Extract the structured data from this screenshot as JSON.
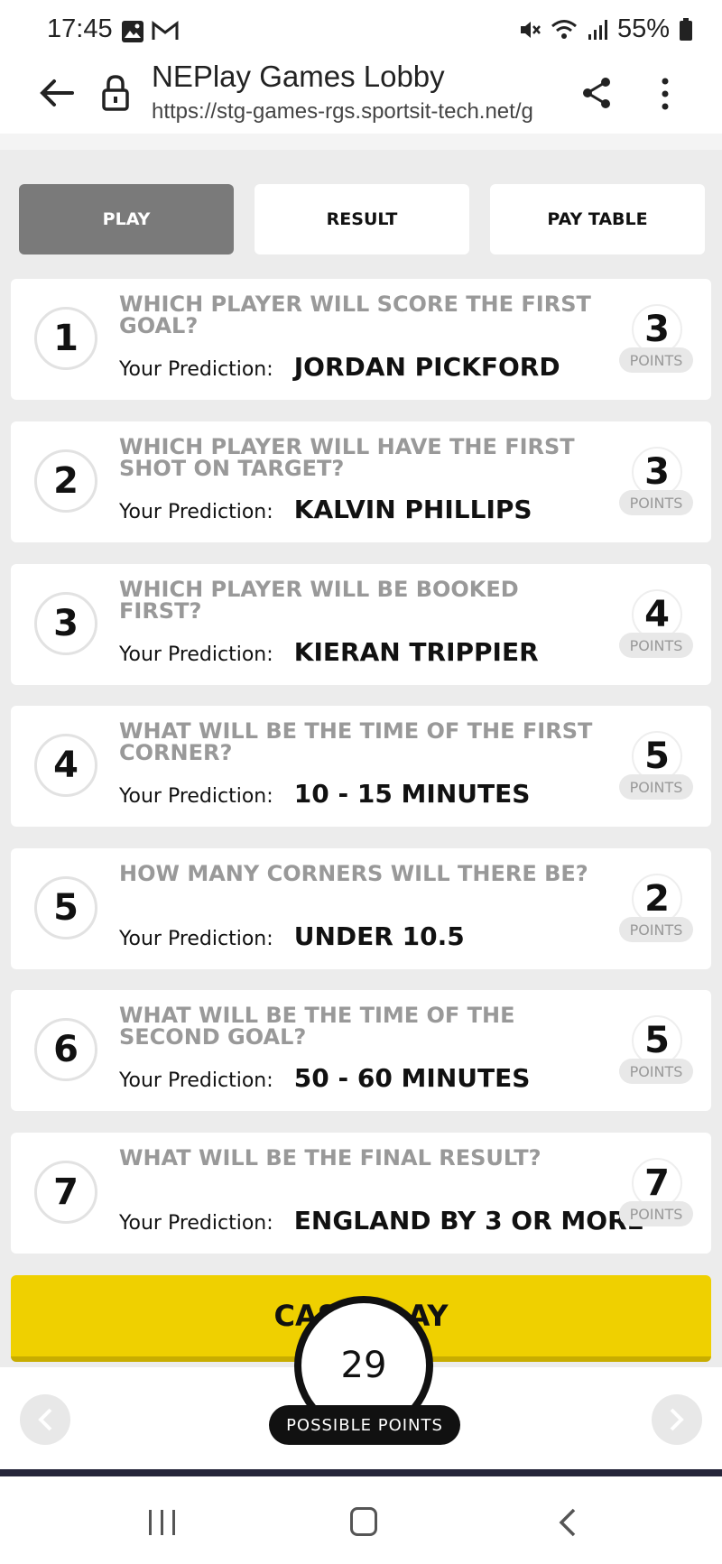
{
  "status": {
    "time": "17:45",
    "battery": "55%"
  },
  "browser": {
    "title": "NEPlay Games Lobby",
    "url": "https://stg-games-rgs.sportsit-tech.net/g"
  },
  "tabs": {
    "play": "PLAY",
    "result": "RESULT",
    "pay_table": "PAY TABLE"
  },
  "prediction_label": "Your Prediction:",
  "points_label": "POINTS",
  "questions": [
    {
      "num": "1",
      "question": "WHICH PLAYER WILL SCORE THE FIRST GOAL?",
      "prediction": "JORDAN PICKFORD",
      "points": "3"
    },
    {
      "num": "2",
      "question": "WHICH PLAYER WILL HAVE THE FIRST SHOT ON TARGET?",
      "prediction": "KALVIN PHILLIPS",
      "points": "3"
    },
    {
      "num": "3",
      "question": "WHICH PLAYER WILL BE BOOKED FIRST?",
      "prediction": "KIERAN TRIPPIER",
      "points": "4"
    },
    {
      "num": "4",
      "question": "WHAT WILL BE THE TIME OF THE FIRST CORNER?",
      "prediction": "10 - 15 MINUTES",
      "points": "5"
    },
    {
      "num": "5",
      "question": "HOW MANY CORNERS WILL THERE BE?",
      "prediction": "UNDER 10.5",
      "points": "2"
    },
    {
      "num": "6",
      "question": "WHAT WILL BE THE TIME OF THE SECOND GOAL?",
      "prediction": "50 - 60 MINUTES",
      "points": "5"
    },
    {
      "num": "7",
      "question": "WHAT WILL BE THE FINAL RESULT?",
      "prediction": "ENGLAND BY 3 OR MORE",
      "points": "7"
    }
  ],
  "cast_button": "CAST PLAY",
  "possible_points": {
    "value": "29",
    "label": "POSSIBLE POINTS"
  },
  "colors": {
    "accent": "#efd000",
    "tab_active": "#7a7a7a",
    "dark": "#111111"
  }
}
